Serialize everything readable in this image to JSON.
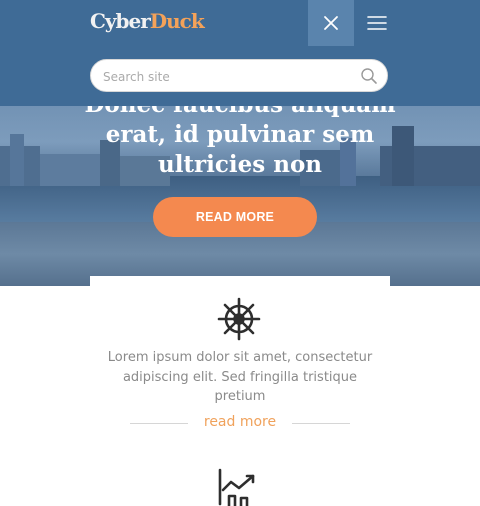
{
  "header": {
    "logo_part1": "Cyber",
    "logo_part2": "Duck",
    "close_icon": "close-icon",
    "menu_icon": "hamburger-menu-icon"
  },
  "search": {
    "placeholder": "Search site",
    "icon": "search-icon"
  },
  "hero": {
    "title": "Donec faucibus aliquam erat, id pulvinar sem ultricies non",
    "cta_label": "READ MORE"
  },
  "feature": {
    "icon": "ship-wheel-icon",
    "text": "Lorem ipsum dolor sit amet, consectetur adipiscing elit. Sed fringilla tristique pretium",
    "link_label": "read more",
    "next_icon": "chart-growth-icon"
  },
  "colors": {
    "header_bg": "#3f6b96",
    "accent": "#f4894f",
    "link": "#f0a25c"
  }
}
